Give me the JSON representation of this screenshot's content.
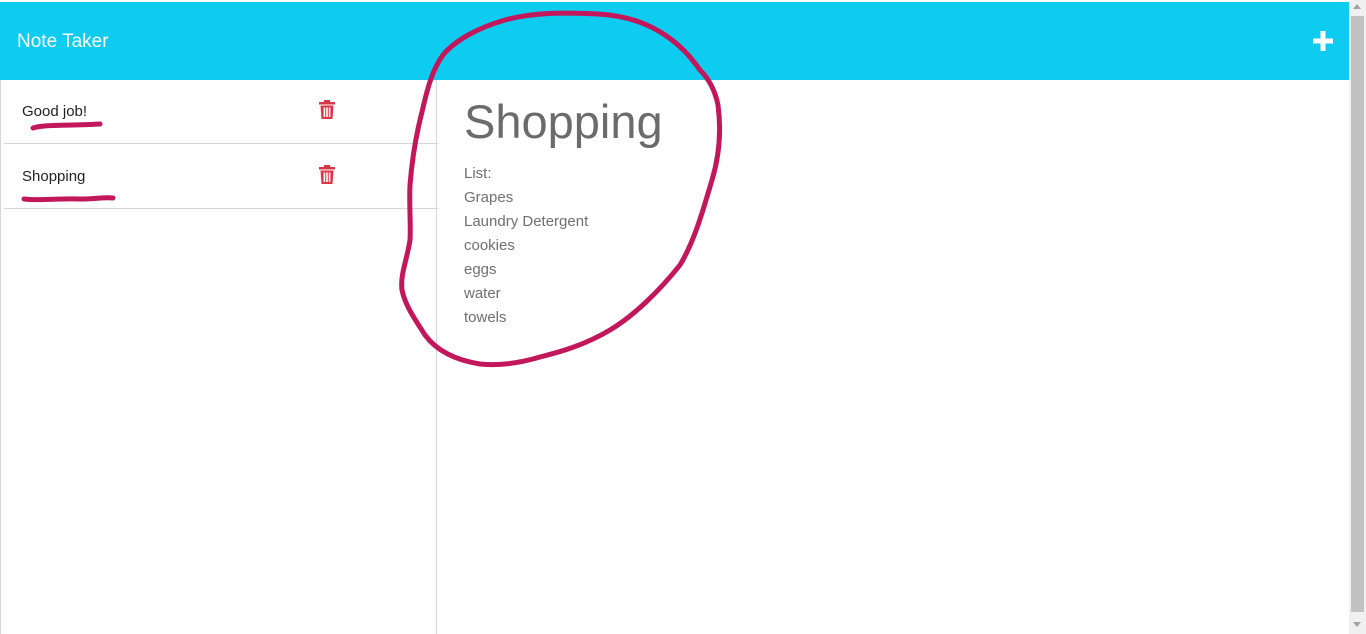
{
  "navbar": {
    "brand": "Note Taker",
    "new_note_icon": "plus-icon",
    "background": "#0ecbf0"
  },
  "sidebar": {
    "notes": [
      {
        "title": "Good job!",
        "delete_icon": "trash-icon"
      },
      {
        "title": "Shopping",
        "delete_icon": "trash-icon"
      }
    ]
  },
  "main": {
    "title": "Shopping",
    "lines": [
      "List:",
      "Grapes",
      "Laundry Detergent",
      "cookies",
      "eggs",
      "water",
      "towels"
    ]
  },
  "colors": {
    "accent": "#0ecbf0",
    "delete": "#dc3545",
    "annotation": "#c2185b"
  }
}
